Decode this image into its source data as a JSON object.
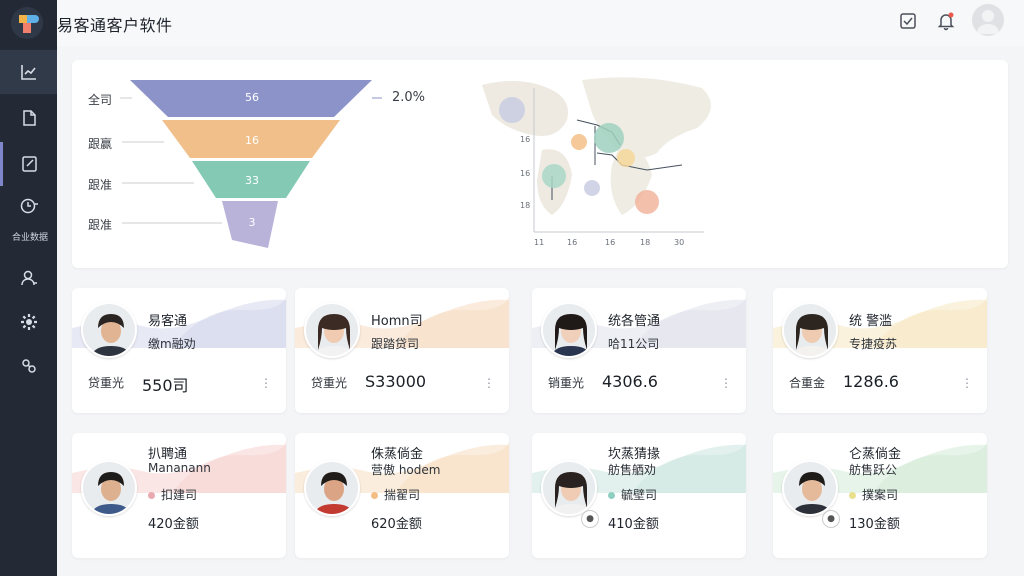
{
  "app": {
    "title": "易客通客户软件"
  },
  "sidebar": {
    "active_label": "合业数据"
  },
  "funnel": {
    "stages": [
      {
        "label": "全司",
        "value": "56",
        "color": "#8c93c9"
      },
      {
        "label": "跟赢",
        "value": "16",
        "color": "#f1bf8a"
      },
      {
        "label": "跟准",
        "value": "33",
        "color": "#84c9b3"
      },
      {
        "label": "跟准",
        "value": "3",
        "color": "#b9b2d9"
      }
    ],
    "rate": "2.0%"
  },
  "map_chart": {
    "y_ticks": [
      "16",
      "16",
      "18"
    ],
    "x_ticks": [
      "11",
      "16",
      "16",
      "18",
      "30"
    ]
  },
  "cards_top": [
    {
      "name": "易客通",
      "role": "缴m融劝",
      "metric_label": "贷重光",
      "metric_value": "550司",
      "accent": "#c9cfe6"
    },
    {
      "name": "Homn司",
      "role": "跟踏贷司",
      "metric_label": "贷重光",
      "metric_value": "S33000",
      "accent": "#f4d3b3"
    },
    {
      "name": "统各管通",
      "role": "哈11公司",
      "metric_label": "销重光",
      "metric_value": "4306.6",
      "accent": "#d9dbe8"
    },
    {
      "name": "统 警滥",
      "role": "专捷疫苏",
      "metric_label": "合重金",
      "metric_value": "1286.6",
      "accent": "#f5e3b3"
    }
  ],
  "cards_bottom": [
    {
      "name": "扒聘通",
      "role": "Mananann",
      "tag": "扣建司",
      "dot_color": "#e8a9b1",
      "amount": "420金额",
      "accent": "#f3c8c6"
    },
    {
      "name": "侏蒸倘金",
      "role": "营傲 hodem",
      "tag": "揣翟司",
      "dot_color": "#f3bd86",
      "amount": "620金额",
      "accent": "#f6d6b3"
    },
    {
      "name": "坎蒸猜掾",
      "role": "舫售舾劝",
      "tag": "毓壁司",
      "dot_color": "#8fcfc1",
      "amount": "410金额",
      "accent": "#bfe0d6"
    },
    {
      "name": "仑蒸倘金",
      "role": "舫售跃公",
      "tag": "撲案司",
      "dot_color": "#e9e08e",
      "amount": "130金额",
      "accent": "#c9e6cf"
    }
  ]
}
